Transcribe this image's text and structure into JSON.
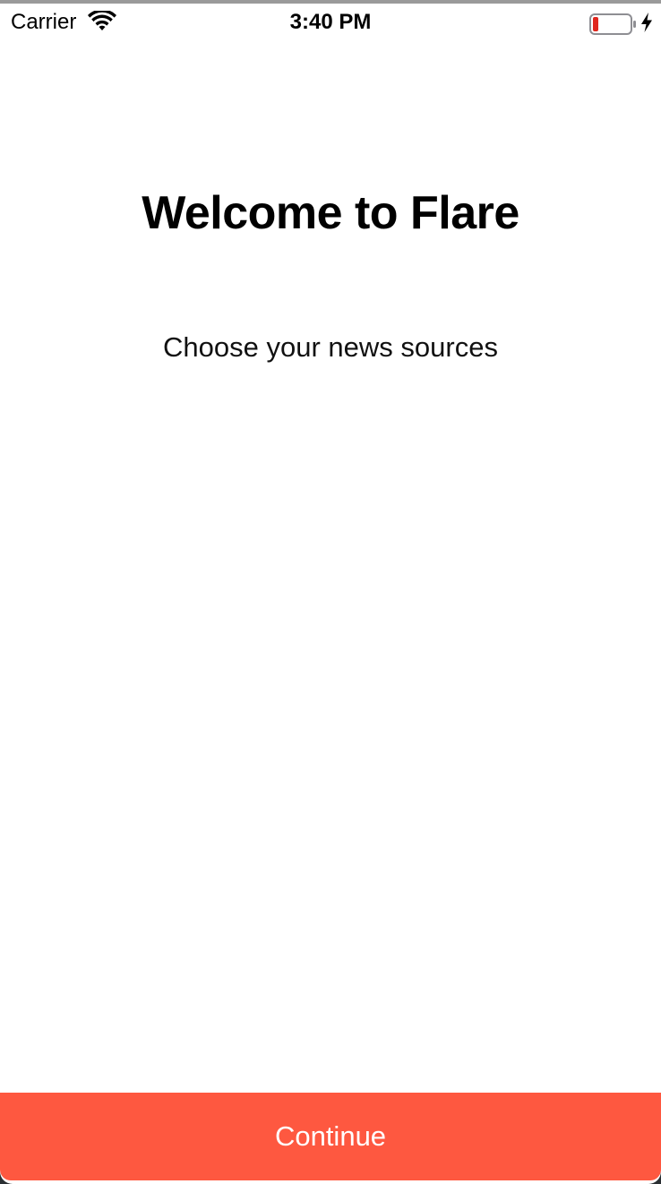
{
  "status_bar": {
    "carrier": "Carrier",
    "time": "3:40 PM",
    "wifi_icon": "wifi-icon",
    "battery_icon": "battery-low-icon",
    "charging_icon": "charging-bolt-icon",
    "battery_level_fraction": 0.15,
    "battery_color": "#e0271e"
  },
  "main": {
    "title": "Welcome to Flare",
    "subtitle": "Choose your news sources"
  },
  "footer": {
    "continue_label": "Continue",
    "accent_color": "#fe5840"
  }
}
